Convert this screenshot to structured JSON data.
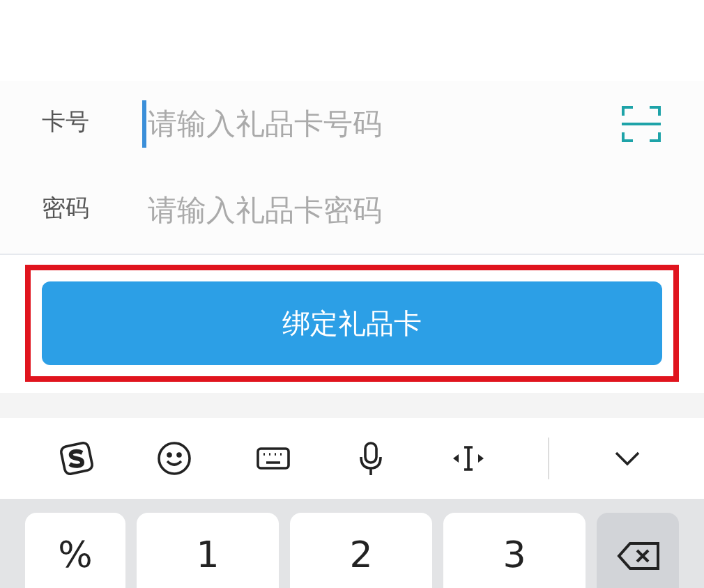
{
  "fields": [
    {
      "label": "卡号",
      "placeholder": "请输入礼品卡号码",
      "focused": true,
      "scan": true
    },
    {
      "label": "密码",
      "placeholder": "请输入礼品卡密码",
      "focused": false,
      "scan": false
    }
  ],
  "bind_button": {
    "label": "绑定礼品卡",
    "highlighted": true
  },
  "keyboard": {
    "toolbar": [
      {
        "kind": "logo"
      },
      {
        "kind": "emoji"
      },
      {
        "kind": "keyboard"
      },
      {
        "kind": "mic"
      },
      {
        "kind": "cursor"
      },
      {
        "kind": "collapse"
      }
    ],
    "keys": [
      {
        "kind": "char",
        "label": "%"
      },
      {
        "kind": "char",
        "label": "1"
      },
      {
        "kind": "char",
        "label": "2"
      },
      {
        "kind": "char",
        "label": "3"
      },
      {
        "kind": "backspace"
      }
    ]
  }
}
